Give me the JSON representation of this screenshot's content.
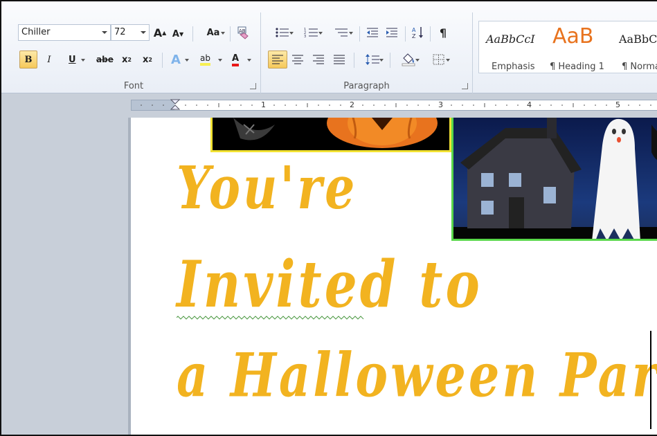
{
  "ribbon": {
    "font": {
      "group_label": "Font",
      "font_name": "Chiller",
      "font_size": "72",
      "grow_label": "A",
      "shrink_label": "A",
      "change_case_label": "Aa",
      "bold_label": "B",
      "italic_label": "I",
      "underline_label": "U",
      "strike_label": "abe",
      "subscript_label": "x",
      "superscript_label": "x",
      "text_effects_label": "A",
      "highlight_label": "ab",
      "font_color_label": "A",
      "highlight_color": "#f7f052",
      "font_color": "#e81818"
    },
    "paragraph": {
      "group_label": "Paragraph",
      "pilcrow_label": "¶"
    },
    "styles": {
      "items": [
        {
          "sample": "AaBbCcI",
          "name": "Emphasis"
        },
        {
          "sample": "AaB",
          "name": "¶ Heading 1"
        },
        {
          "sample": "AaBbC",
          "name": "¶ Norma"
        }
      ],
      "heading_color": "#e8731e"
    }
  },
  "ruler": {
    "numbers": [
      "1",
      "2",
      "3",
      "4",
      "5"
    ]
  },
  "document": {
    "lines": [
      "You're",
      "Invited to",
      "a Halloween Party"
    ],
    "text_color": "#f2b320"
  }
}
